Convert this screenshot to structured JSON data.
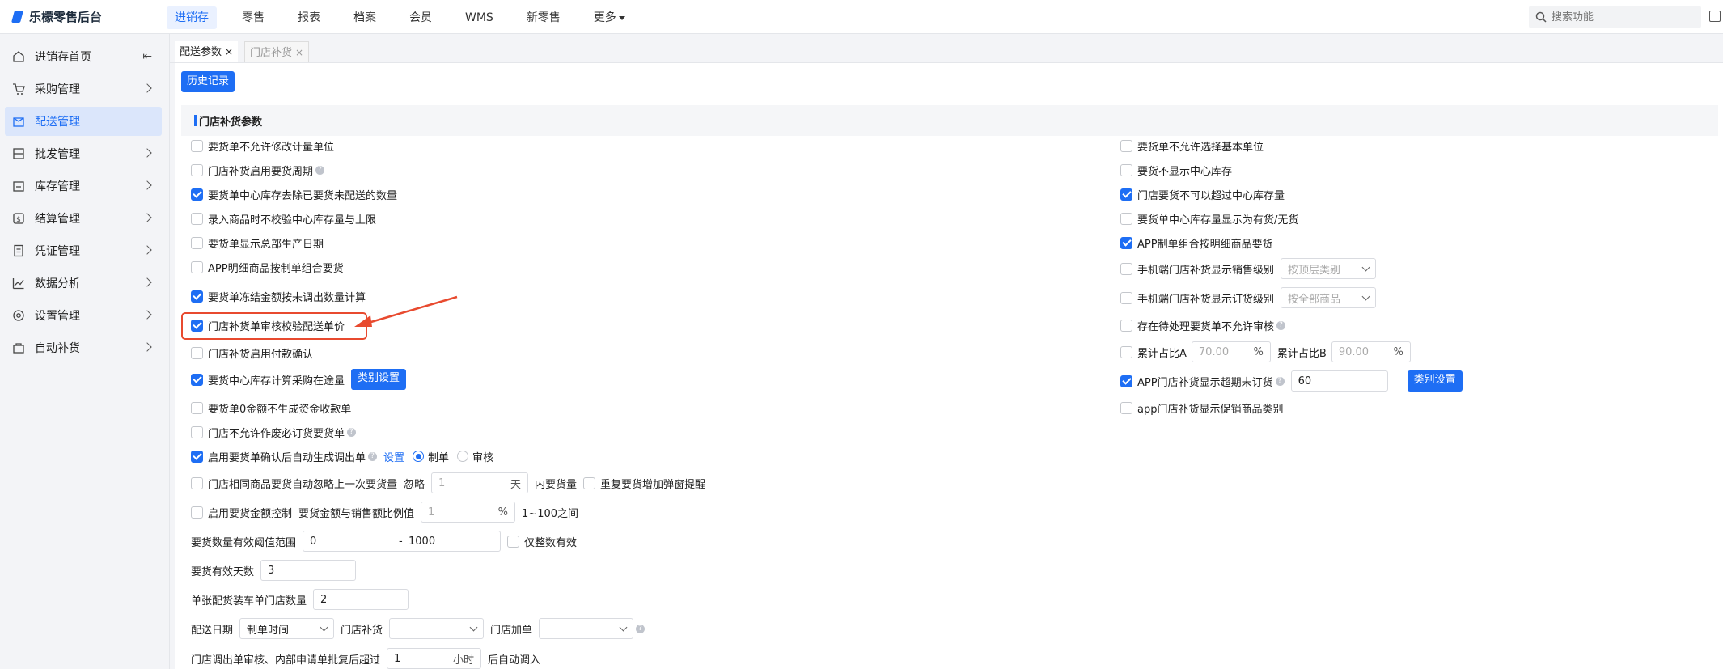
{
  "app": {
    "title": "乐檬零售后台"
  },
  "nav": {
    "items": [
      "进销存",
      "零售",
      "报表",
      "档案",
      "会员",
      "WMS",
      "新零售",
      "更多"
    ],
    "active": "进销存"
  },
  "search": {
    "placeholder": "搜索功能"
  },
  "sidebar": {
    "items": [
      {
        "label": "进销存首页",
        "icon": "inventory-home-icon"
      },
      {
        "label": "采购管理",
        "icon": "cart-icon"
      },
      {
        "label": "配送管理",
        "icon": "delivery-icon",
        "active": true
      },
      {
        "label": "批发管理",
        "icon": "wholesale-icon"
      },
      {
        "label": "库存管理",
        "icon": "stock-icon"
      },
      {
        "label": "结算管理",
        "icon": "settlement-icon"
      },
      {
        "label": "凭证管理",
        "icon": "voucher-icon"
      },
      {
        "label": "数据分析",
        "icon": "chart-icon"
      },
      {
        "label": "设置管理",
        "icon": "settings-icon"
      },
      {
        "label": "自动补货",
        "icon": "auto-replenish-icon"
      }
    ]
  },
  "tabs": [
    {
      "label": "配送参数",
      "close": "×",
      "active": true
    },
    {
      "label": "门店补货",
      "close": "×",
      "active": false
    }
  ],
  "history_button": "历史记录",
  "section_title": "门店补货参数",
  "left": {
    "r1": "要货单不允许修改计量单位",
    "r2": "门店补货启用要货周期",
    "r3": "要货单中心库存去除已要货未配送的数量",
    "r4": "录入商品时不校验中心库存量与上限",
    "r5": "要货单显示总部生产日期",
    "r6": "APP明细商品按制单组合要货",
    "r7": "要货单冻结金额按未调出数量计算",
    "r8": "门店补货单审核校验配送单价",
    "r9": "门店补货启用付款确认",
    "r10": "要货中心库存计算采购在途量",
    "r10_btn": "类别设置",
    "r11": "要货单0金额不生成资金收款单",
    "r12": "门店不允许作废必订货要货单",
    "r13": "启用要货单确认后自动生成调出单",
    "r13_link": "设置",
    "r13_opt1": "制单",
    "r13_opt2": "审核",
    "r14": "门店相同商品要货自动忽略上一次要货量",
    "r14_ignore": "忽略",
    "r14_value": "1",
    "r14_unit": "天",
    "r14_after": "内要货量",
    "r14_popup": "重复要货增加弹窗提醒",
    "r15": "启用要货金额控制",
    "r15_label": "要货金额与销售额比例值",
    "r15_value": "1",
    "r15_unit": "%",
    "r15_range": "1~100之间",
    "r16_label": "要货数量有效阈值范围",
    "r16_min": "0",
    "r16_dash": "-",
    "r16_max": "1000",
    "r16_integer": "仅整数有效",
    "r17_label": "要货有效天数",
    "r17_value": "3",
    "r18_label": "单张配货装车单门店数量",
    "r18_value": "2",
    "r19_label": "配送日期",
    "r19_sel": "制单时间",
    "r19_label2": "门店补货",
    "r19_label3": "门店加单",
    "r20_label": "门店调出单审核、内部申请单批复后超过",
    "r20_value": "1",
    "r20_unit": "小时",
    "r20_after": "后自动调入"
  },
  "right": {
    "r1": "要货单不允许选择基本单位",
    "r2": "要货不显示中心库存",
    "r3": "门店要货不可以超过中心库存量",
    "r4": "要货单中心库存量显示为有货/无货",
    "r5": "APP制单组合按明细商品要货",
    "r6": "手机端门店补货显示销售级别",
    "r6_sel": "按顶层类别",
    "r7": "手机端门店补货显示订货级别",
    "r7_sel": "按全部商品",
    "r8": "存在待处理要货单不允许审核",
    "r9a": "累计占比A",
    "r9a_val": "70.00",
    "r9_unit": "%",
    "r9b": "累计占比B",
    "r9b_val": "90.00",
    "r10": "APP门店补货显示超期未订货",
    "r10_val": "60",
    "r10_btn": "类别设置",
    "r11": "app门店补货显示促销商品类别"
  },
  "checks": {
    "left": [
      false,
      false,
      true,
      false,
      false,
      false,
      true,
      true,
      false,
      true,
      false,
      false,
      true,
      false,
      false
    ],
    "right": [
      false,
      false,
      true,
      false,
      true,
      false,
      false,
      false,
      false,
      true,
      false
    ]
  },
  "colors": {
    "accent": "#1e6ef4",
    "highlight": "#e84a2f"
  }
}
